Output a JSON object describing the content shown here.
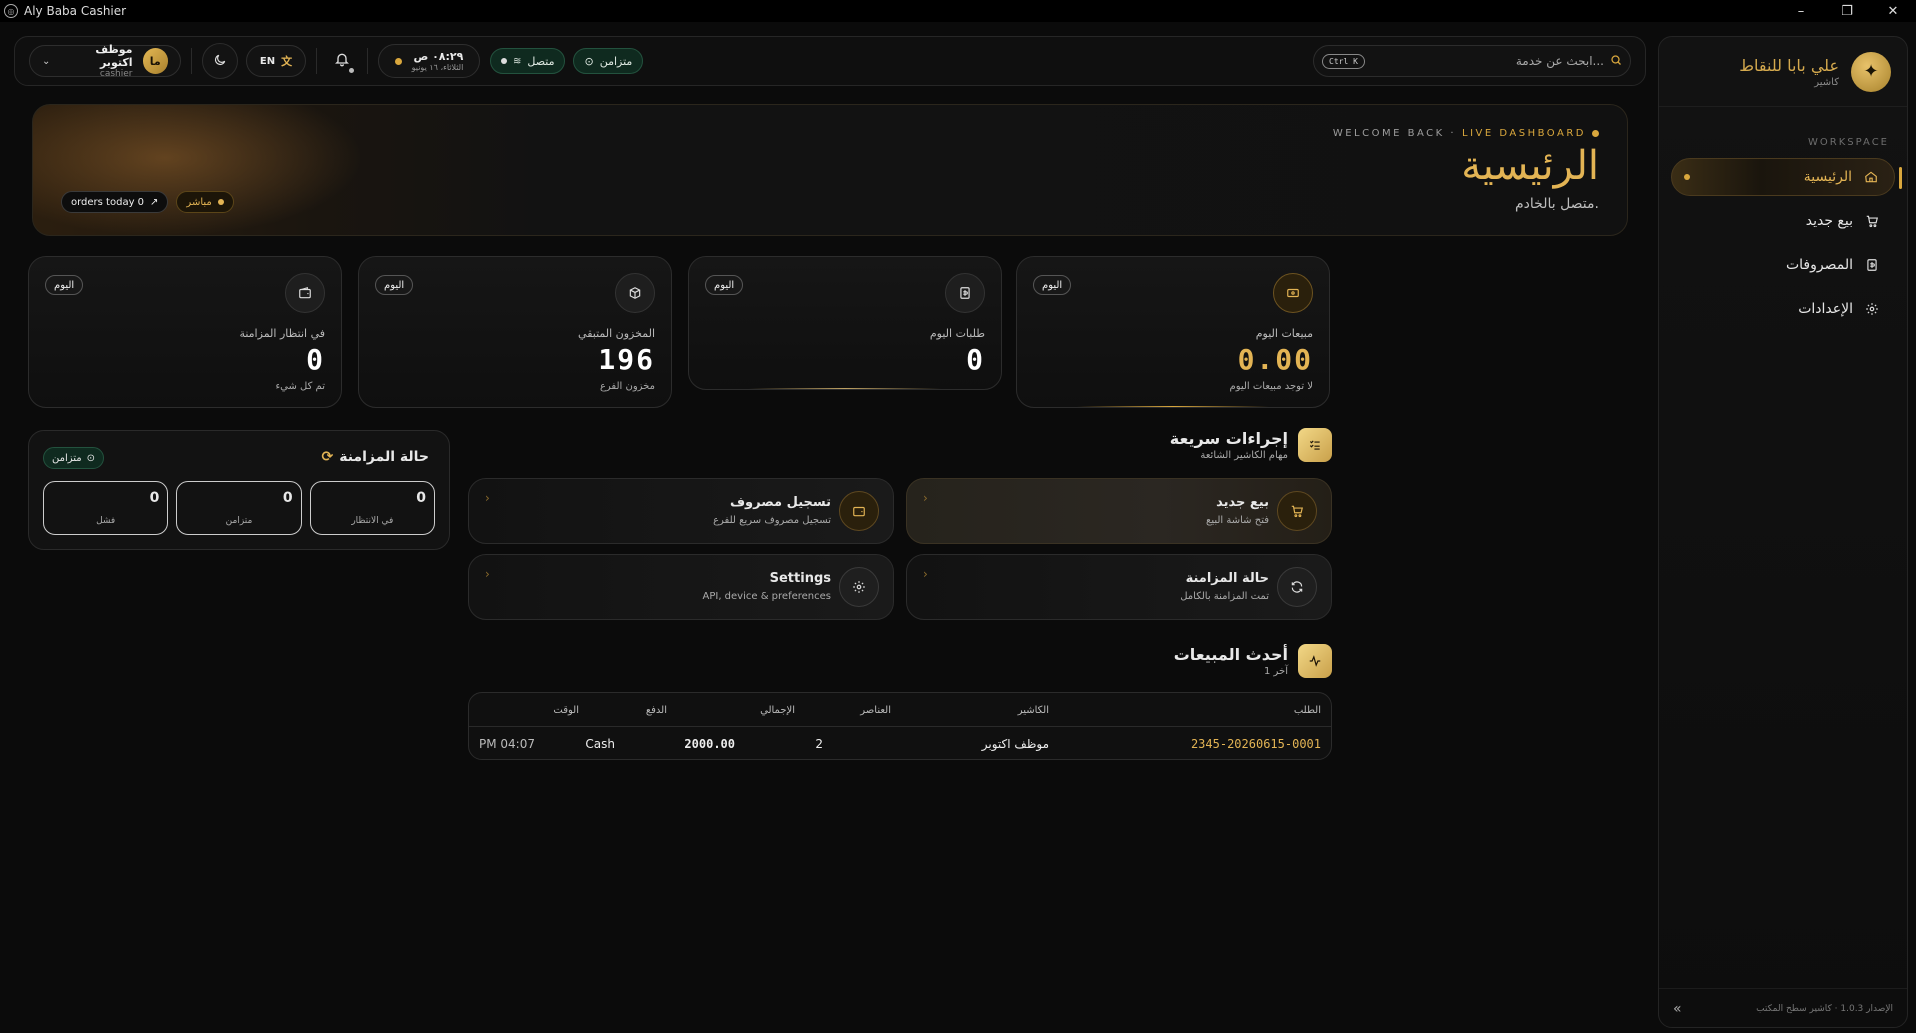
{
  "window": {
    "title": "Aly Baba Cashier",
    "minimize": "–",
    "restore": "❐",
    "close": "✕"
  },
  "sidebar": {
    "brand_name": "علي بابا للنقاط",
    "brand_sub": "كاشير",
    "section": "WORKSPACE",
    "items": [
      {
        "label": "الرئيسية",
        "icon": "home-icon"
      },
      {
        "label": "بيع جديد",
        "icon": "cart-icon"
      },
      {
        "label": "المصروفات",
        "icon": "receipt-icon"
      },
      {
        "label": "الإعدادات",
        "icon": "gear-icon"
      }
    ],
    "version": "الإصدار 1.0.3 · كاشير سطح المكتب",
    "collapse": "»"
  },
  "topbar": {
    "user_name": "موظف اكتوبر",
    "user_role": "cashier",
    "avatar": "ما",
    "lang": "EN",
    "clock_time": "٠٨:٢٩ ص",
    "clock_date": "الثلاثاء، ١٦ يونيو",
    "connected": "متصل",
    "synced": "متزامن",
    "search_placeholder": "ابحث عن خدمة...",
    "shortcut": "Ctrl K"
  },
  "hero": {
    "eyebrow_left": "WELCOME BACK ·",
    "eyebrow_live": "LIVE DASHBOARD",
    "title": "الرئيسية",
    "subtitle": "متصل بالخادم.",
    "pill_live": "مباشر",
    "pill_orders": "orders today 0"
  },
  "stats": [
    {
      "badge": "اليوم",
      "label": "مبيعات اليوم",
      "value": "0.00",
      "sub": "لا توجد مبيعات اليوم"
    },
    {
      "badge": "اليوم",
      "label": "طلبات اليوم",
      "value": "0",
      "sub": ""
    },
    {
      "badge": "اليوم",
      "label": "المخزون المتبقي",
      "value": "196",
      "sub": "مخزون الفرع"
    },
    {
      "badge": "اليوم",
      "label": "في انتظار المزامنة",
      "value": "0",
      "sub": "تم كل شيء"
    }
  ],
  "sync": {
    "title": "حالة المزامنة",
    "status": "متزامن",
    "boxes": [
      {
        "value": "0",
        "label": "في الانتظار"
      },
      {
        "value": "0",
        "label": "متزامن"
      },
      {
        "value": "0",
        "label": "فشل"
      }
    ]
  },
  "quick": {
    "title": "إجراءات سريعة",
    "subtitle": "مهام الكاشير الشائعة",
    "actions": [
      {
        "title": "بيع جديد",
        "sub": "فتح شاشة البيع"
      },
      {
        "title": "تسجيل مصروف",
        "sub": "تسجيل مصروف سريع للفرع"
      },
      {
        "title": "حالة المزامنة",
        "sub": "تمت المزامنة بالكامل"
      },
      {
        "title": "Settings",
        "sub": "API, device & preferences"
      }
    ],
    "chevron": "‹"
  },
  "recent": {
    "title": "أحدث المبيعات",
    "subtitle": "آخر 1",
    "columns": [
      "الطلب",
      "الكاشير",
      "العناصر",
      "الإجمالي",
      "الدفع",
      "الوقت"
    ],
    "rows": [
      {
        "order": "2345-20260615-0001",
        "cashier": "موظف اكتوبر",
        "items": "2",
        "total": "2000.00",
        "payment": "Cash",
        "time": "PM 04:07"
      }
    ]
  }
}
